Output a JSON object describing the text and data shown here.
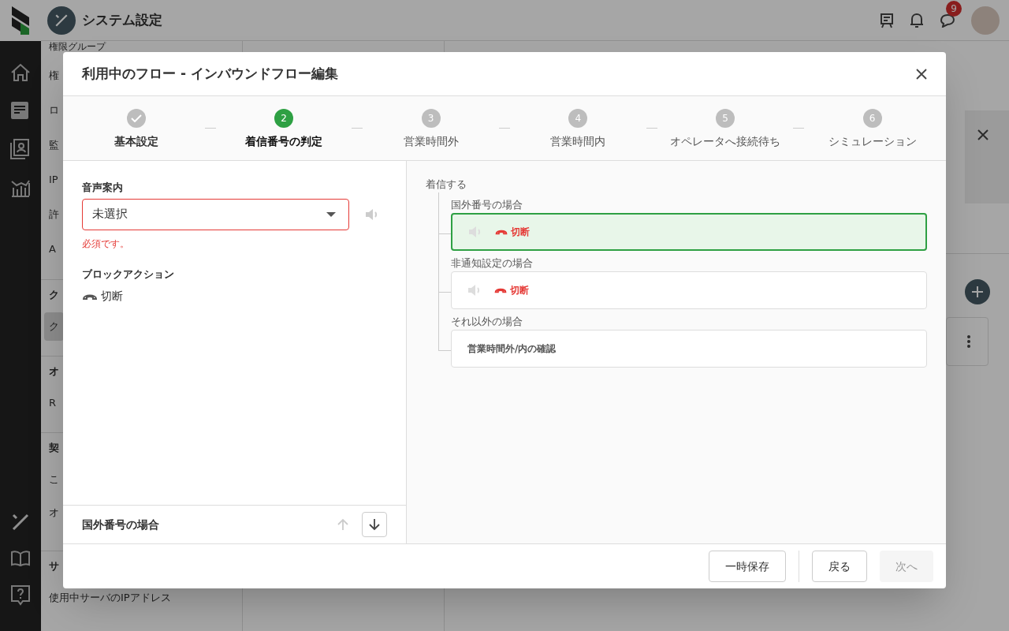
{
  "app_bar": {
    "title": "システム設定",
    "notification_count": "9"
  },
  "side_menu": {
    "sections": [
      {
        "items": [
          {
            "label": "権限グループ",
            "selected": false
          },
          {
            "label": "権",
            "selected": false
          },
          {
            "label": "ロ",
            "selected": false
          },
          {
            "label": "監",
            "selected": false
          },
          {
            "label": "IP",
            "selected": false
          },
          {
            "label": "許",
            "selected": false
          },
          {
            "label": "A",
            "selected": false
          }
        ]
      },
      {
        "heading": "ク",
        "items": [
          {
            "label": "ク",
            "selected": true
          }
        ]
      },
      {
        "heading": "オ",
        "items": [
          {
            "label": "R",
            "selected": false
          }
        ]
      },
      {
        "heading": "契",
        "items": [
          {
            "label": "こ",
            "selected": false
          },
          {
            "label": "オ",
            "selected": false
          }
        ]
      },
      {
        "heading": "サ",
        "items": [
          {
            "label": "使用中サーバのIPアドレス",
            "selected": false
          }
        ]
      }
    ]
  },
  "dialog": {
    "title": "利用中のフロー - インバウンドフロー編集",
    "steps": [
      {
        "label": "基本設定",
        "completed": true,
        "selected": false
      },
      {
        "number": "2",
        "label": "着信番号の判定",
        "completed": false,
        "selected": true
      },
      {
        "number": "3",
        "label": "営業時間外",
        "completed": false,
        "selected": false
      },
      {
        "number": "4",
        "label": "営業時間内",
        "completed": false,
        "selected": false
      },
      {
        "number": "5",
        "label": "オペレータへ接続待ち",
        "completed": false,
        "selected": false
      },
      {
        "number": "6",
        "label": "シミュレーション",
        "completed": false,
        "selected": false
      }
    ],
    "voice_guide": {
      "label": "音声案内",
      "value": "未選択",
      "invalid": true,
      "error": "必須です。"
    },
    "block_action": {
      "label": "ブロックアクション",
      "action": "切断"
    },
    "selected_branch": {
      "label": "国外番号の場合",
      "can_move_up": false,
      "can_move_down": true
    },
    "flow": {
      "root": "着信する",
      "branches": [
        {
          "condition": "国外番号の場合",
          "selected": true,
          "kind": "action",
          "action": "切断"
        },
        {
          "condition": "非通知設定の場合",
          "selected": false,
          "kind": "action",
          "action": "切断"
        },
        {
          "condition": "それ以外の場合",
          "selected": false,
          "kind": "next",
          "label": "営業時間外/内の確認"
        }
      ]
    },
    "buttons": [
      {
        "label": "一時保存",
        "disabled": false
      },
      {
        "label": "戻る",
        "disabled": false
      },
      {
        "label": "次へ",
        "disabled": true
      }
    ]
  }
}
